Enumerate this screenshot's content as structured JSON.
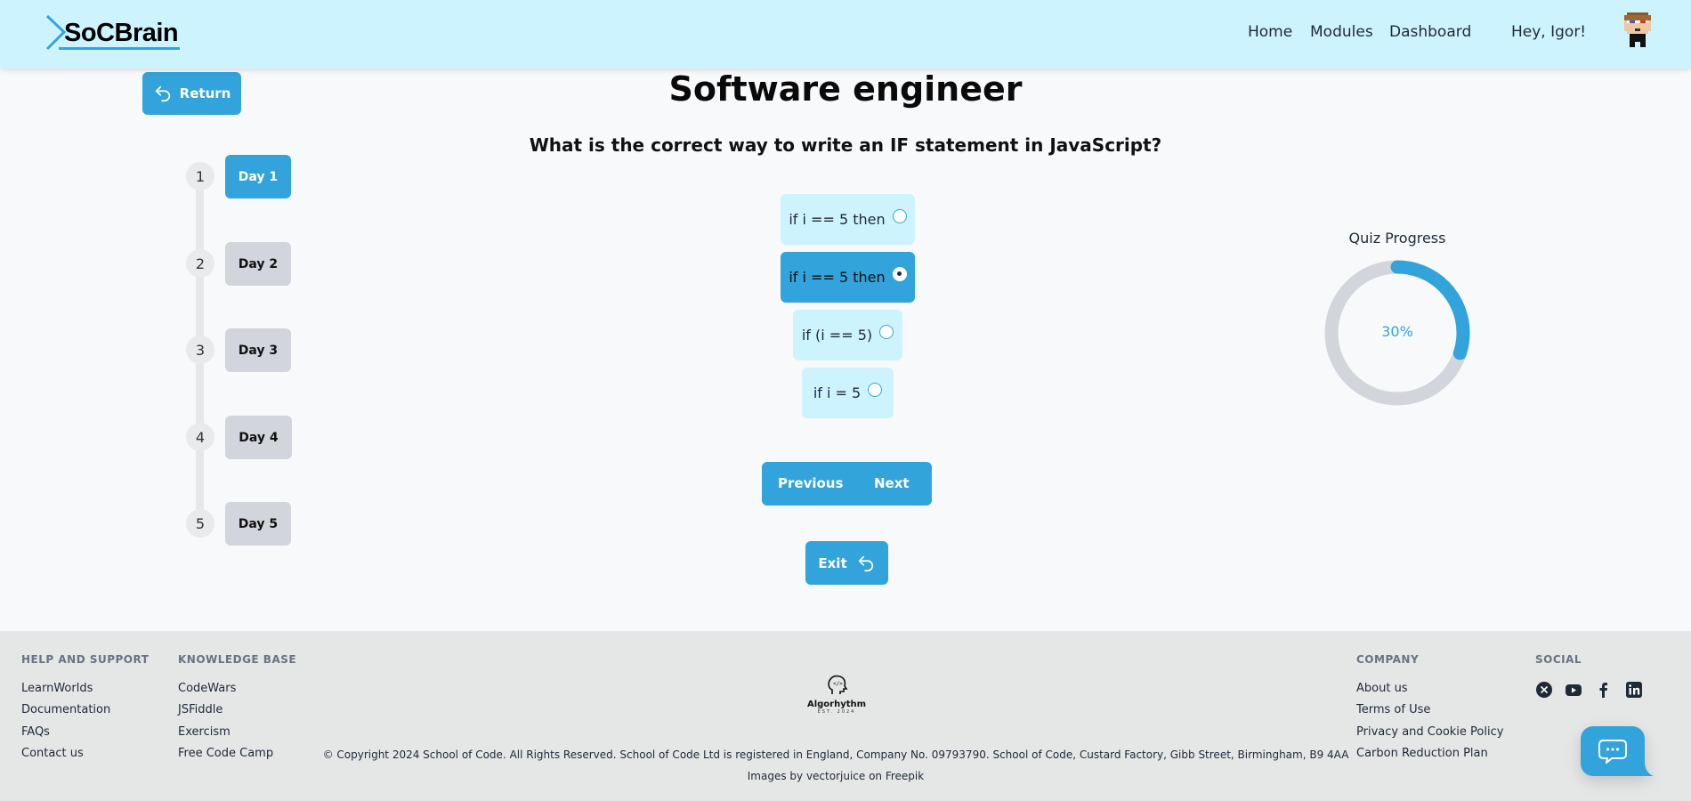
{
  "header": {
    "logo_text": "SoCBrain",
    "nav": [
      {
        "label": "Home"
      },
      {
        "label": "Modules"
      },
      {
        "label": "Dashboard"
      }
    ],
    "greeting": "Hey, Igor!",
    "avatar_icon": "pixel-character-avatar"
  },
  "return_button": {
    "label": "Return",
    "icon": "undo-arrow-icon"
  },
  "main": {
    "title": "Software engineer",
    "question": "What is the correct way to write an IF statement in JavaScript?",
    "options": [
      {
        "label": "if i == 5 then",
        "selected": false
      },
      {
        "label": "if i == 5 then",
        "selected": true
      },
      {
        "label": "if (i == 5)",
        "selected": false
      },
      {
        "label": "if i = 5",
        "selected": false
      }
    ],
    "previous_label": "Previous",
    "next_label": "Next",
    "exit_label": "Exit"
  },
  "timeline": {
    "steps": [
      {
        "number": "1",
        "label": "Day 1",
        "active": true
      },
      {
        "number": "2",
        "label": "Day 2",
        "active": false
      },
      {
        "number": "3",
        "label": "Day 3",
        "active": false
      },
      {
        "number": "4",
        "label": "Day 4",
        "active": false
      },
      {
        "number": "5",
        "label": "Day 5",
        "active": false
      }
    ]
  },
  "progress": {
    "label": "Quiz Progress",
    "value_text": "30%",
    "fraction": 0.3,
    "colors": {
      "fill": "#32a3db",
      "track": "#d2d5db"
    }
  },
  "footer": {
    "help": {
      "heading": "HELP AND SUPPORT",
      "links": [
        "LearnWorlds",
        "Documentation",
        "FAQs",
        "Contact us"
      ]
    },
    "knowledge": {
      "heading": "KNOWLEDGE BASE",
      "links": [
        "CodeWars",
        "JSFiddle",
        "Exercism",
        "Free Code Camp"
      ]
    },
    "company": {
      "heading": "COMPANY",
      "links": [
        "About us",
        "Terms of Use",
        "Privacy and Cookie Policy",
        "Carbon Reduction Plan"
      ]
    },
    "social": {
      "heading": "SOCIAL",
      "icons": [
        "x-twitter-icon",
        "youtube-icon",
        "facebook-icon",
        "linkedin-icon"
      ]
    },
    "brand_logo": {
      "name": "Algorhythm",
      "tagline": "EST. 2024"
    },
    "copyright": "© Copyright 2024 School of Code. All Rights Reserved. School of Code Ltd is registered in England, Company No. 09793790. School of Code, Custard Factory, Gibb Street, Birmingham, B9 4AA",
    "credits": "Images by vectorjuice on Freepik"
  },
  "theme": {
    "accent": "#32a3db",
    "header_bg": "#cdf4fe",
    "footer_bg": "#e5e6e6"
  }
}
